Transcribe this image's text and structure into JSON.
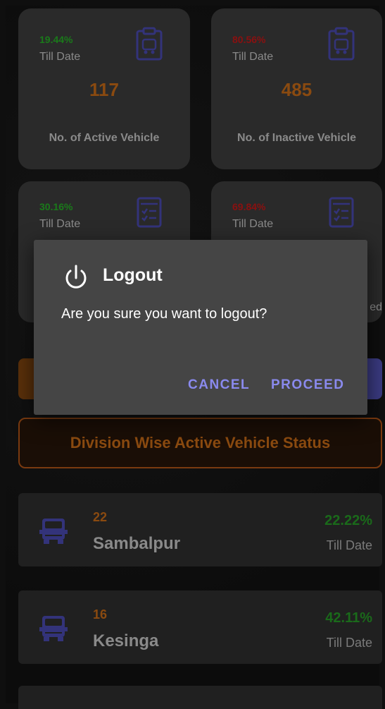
{
  "cards": [
    {
      "percent": "19.44%",
      "percent_color": "#1a7a1a",
      "till": "Till Date",
      "count": "117",
      "label": "No. of Active Vehicle",
      "icon": "clipboard-vehicle-icon"
    },
    {
      "percent": "80.56%",
      "percent_color": "#8a1010",
      "till": "Till Date",
      "count": "485",
      "label": "No. of Inactive Vehicle",
      "icon": "clipboard-vehicle-icon"
    },
    {
      "percent": "30.16%",
      "percent_color": "#1a7a1a",
      "till": "Till Date",
      "icon": "checklist-icon"
    },
    {
      "percent": "69.84%",
      "percent_color": "#8a1010",
      "till": "Till Date",
      "icon": "checklist-icon",
      "label_fragment": "ed"
    }
  ],
  "division_title": "Division Wise Active Vehicle Status",
  "divisions": [
    {
      "count": "22",
      "name": "Sambalpur",
      "percent": "22.22%",
      "till": "Till Date"
    },
    {
      "count": "16",
      "name": "Kesinga",
      "percent": "42.11%",
      "till": "Till Date"
    }
  ],
  "dialog": {
    "icon": "power-icon",
    "title": "Logout",
    "message": "Are you sure you want to logout?",
    "cancel": "CANCEL",
    "proceed": "PROCEED"
  },
  "colors": {
    "accent": "#8a8aee",
    "count_orange": "#8a4a10",
    "positive": "#1a7a1a",
    "negative": "#8a1010"
  }
}
